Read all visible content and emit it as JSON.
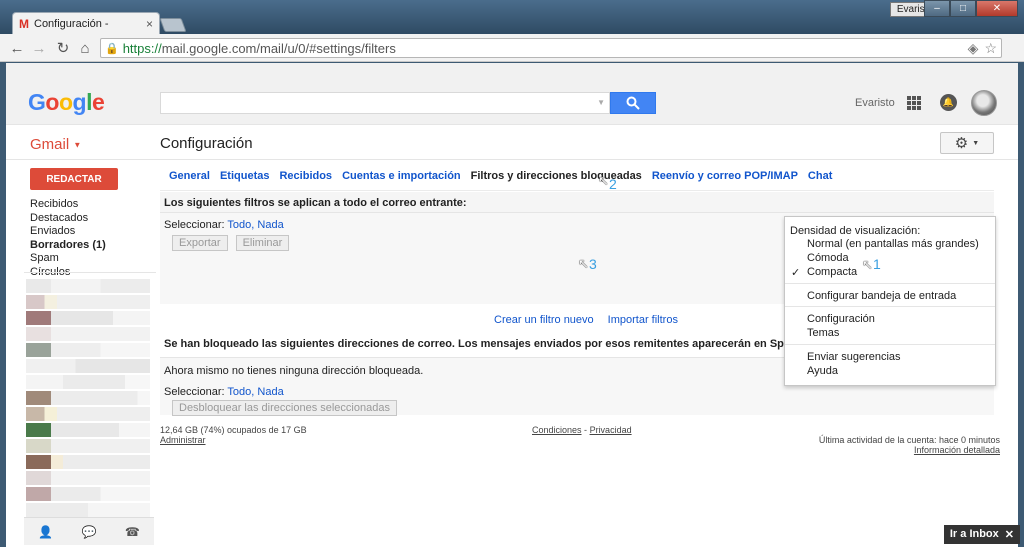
{
  "browser": {
    "tab_title": "Configuración -",
    "url_https": "https://",
    "url_rest": "mail.google.com/mail/u/0/#settings/filters",
    "window_user": "Evaristo",
    "win_minimize": "–",
    "win_maximize": "□",
    "win_close": "✕"
  },
  "header": {
    "logo_letters": [
      "G",
      "o",
      "o",
      "g",
      "l",
      "e"
    ],
    "logo_colors": [
      "#4285f4",
      "#ea4335",
      "#fbbc05",
      "#4285f4",
      "#34a853",
      "#ea4335"
    ],
    "user_name": "Evaristo"
  },
  "subheader": {
    "gmail_label": "Gmail",
    "page_title": "Configuración"
  },
  "left_nav": {
    "compose": "REDACTAR",
    "items": [
      "Recibidos",
      "Destacados",
      "Enviados",
      "Borradores (1)",
      "Spam",
      "Círculos"
    ]
  },
  "settings_tabs": [
    "General",
    "Etiquetas",
    "Recibidos",
    "Cuentas e importación",
    "Filtros y direcciones bloqueadas",
    "Reenvío y correo POP/IMAP",
    "Chat"
  ],
  "filters": {
    "title": "Los siguientes filtros se aplican a todo el correo entrante:",
    "select_label": "Seleccionar:",
    "select_all": "Todo,",
    "select_none": "Nada",
    "export_button": "Exportar",
    "delete_button": "Eliminar",
    "create_filter": "Crear un filtro nuevo",
    "import_filters": "Importar filtros"
  },
  "blocked": {
    "title": "Se han bloqueado las siguientes direcciones de correo. Los mensajes enviados por esos remitentes aparecerán en Spam.:",
    "empty_text": "Ahora mismo no tienes ninguna dirección bloqueada.",
    "select_label": "Seleccionar:",
    "select_all": "Todo,",
    "select_none": "Nada",
    "unblock_button": "Desbloquear las direcciones seleccionadas"
  },
  "footer": {
    "storage": "12,64 GB (74%) ocupados de 17 GB",
    "storage_fraction": 0.74,
    "manage": "Administrar",
    "terms": "Condiciones",
    "sep": "-",
    "privacy": "Privacidad",
    "last_activity": "Última actividad de la cuenta: hace 0 minutos",
    "details": "Información detallada"
  },
  "dropdown": {
    "density_label": "Densidad de visualización:",
    "density_options": [
      "Normal (en pantallas más grandes)",
      "Cómoda",
      "Compacta"
    ],
    "selected_density": "Compacta",
    "check": "✓",
    "configure_inbox": "Configurar bandeja de entrada",
    "settings": "Configuración",
    "themes": "Temas",
    "send_feedback": "Enviar sugerencias",
    "help": "Ayuda"
  },
  "annotations": {
    "step1": "1",
    "step2": "2",
    "step3": "3"
  },
  "inbox_chip": {
    "label": "Ir a Inbox",
    "close": "✕"
  }
}
